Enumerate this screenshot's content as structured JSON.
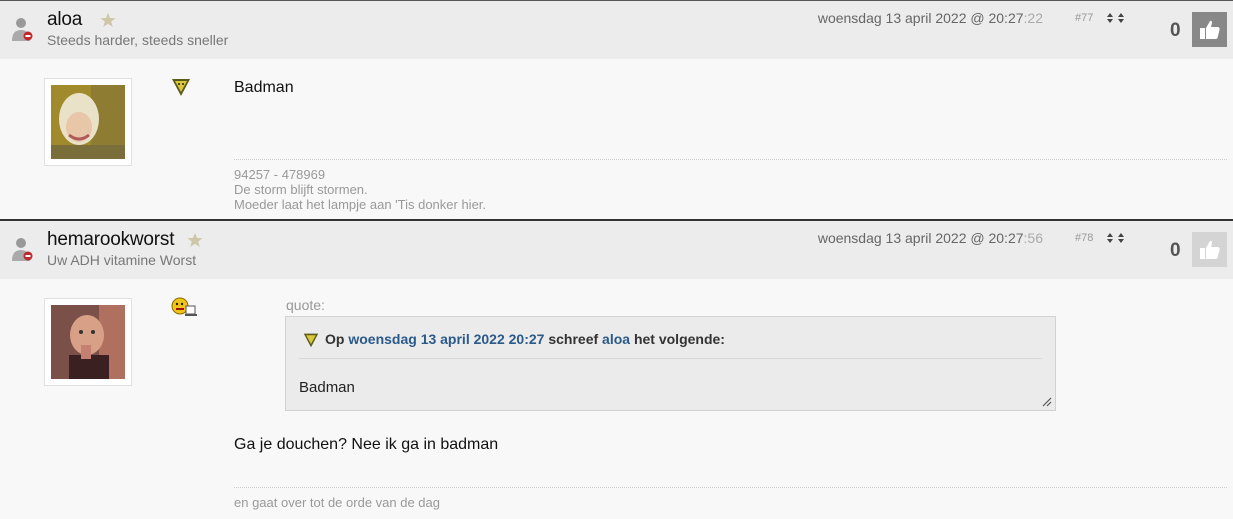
{
  "posts": [
    {
      "username": "aloa",
      "subtitle": "Steeds harder, steeds sneller",
      "date": "woensdag 13 april 2022 @ 20:27",
      "seconds": ":22",
      "post_number": "#77",
      "score": "0",
      "body_text": "Badman",
      "signature": [
        "94257 - 478969",
        "De storm blijft stormen.",
        "Moeder laat het lampje aan 'Tis donker hier."
      ]
    },
    {
      "username": "hemarookworst",
      "subtitle": "Uw ADH vitamine Worst",
      "date": "woensdag 13 april 2022 @ 20:27",
      "seconds": ":56",
      "post_number": "#78",
      "score": "0",
      "quote": {
        "label": "quote:",
        "prefix": "Op",
        "date_link": "woensdag 13 april 2022 20:27",
        "middle": "schreef",
        "author_link": "aloa",
        "suffix": "het volgende:",
        "text": "Badman"
      },
      "body_text": "Ga je douchen? Nee ik ga in badman",
      "signature": [
        "en gaat over tot de orde van de dag"
      ]
    }
  ],
  "icons": {
    "user": "user-offline-icon",
    "star": "star-icon",
    "like": "thumbs-up-icon",
    "vote": "up-down-arrows-icon"
  },
  "colors": {
    "header_bg": "#ececec",
    "link": "#2a5a8a",
    "like_active": "#888888",
    "like_inactive": "#d4d4d4"
  }
}
